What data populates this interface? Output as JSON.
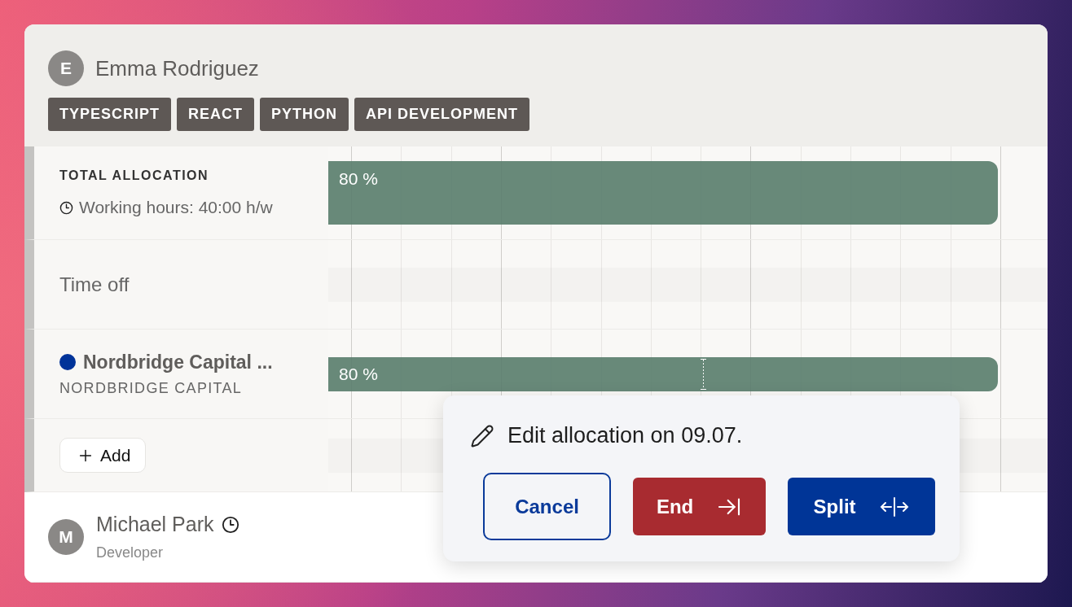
{
  "person": {
    "initial": "E",
    "name": "Emma Rodriguez",
    "skills": [
      "TYPESCRIPT",
      "REACT",
      "PYTHON",
      "API DEVELOPMENT"
    ]
  },
  "total_allocation": {
    "label": "TOTAL ALLOCATION",
    "working_hours": "Working hours: 40:00 h/w",
    "bar_label": "80 %"
  },
  "time_off": {
    "label": "Time off"
  },
  "projects": [
    {
      "name": "Nordbridge Capital ...",
      "client": "NORDBRIDGE CAPITAL",
      "color": "#003399",
      "bar_label": "80 %"
    }
  ],
  "add_button": "Add",
  "next_person": {
    "initial": "M",
    "name": "Michael Park",
    "role": "Developer"
  },
  "popup": {
    "title": "Edit allocation on 09.07.",
    "buttons": [
      {
        "label": "Cancel",
        "kind": "outline"
      },
      {
        "label": "End",
        "kind": "end"
      },
      {
        "label": "Split",
        "kind": "split"
      }
    ]
  }
}
